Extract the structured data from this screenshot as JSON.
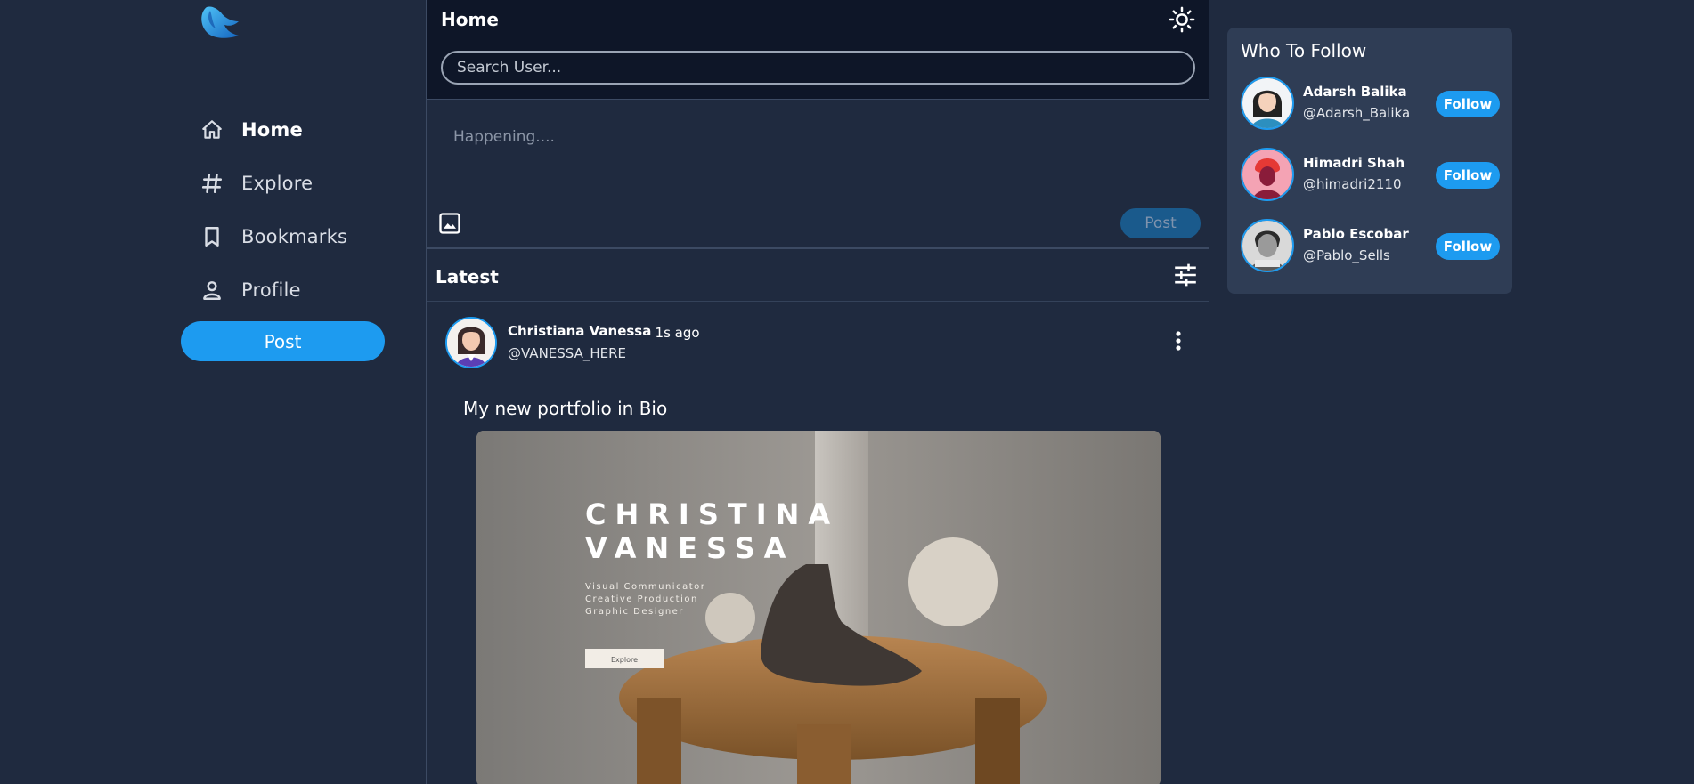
{
  "nav": {
    "items": [
      {
        "label": "Home",
        "icon": "home-icon",
        "active": true
      },
      {
        "label": "Explore",
        "icon": "hash-icon",
        "active": false
      },
      {
        "label": "Bookmarks",
        "icon": "bookmark-icon",
        "active": false
      },
      {
        "label": "Profile",
        "icon": "person-icon",
        "active": false
      }
    ],
    "post_label": "Post"
  },
  "header": {
    "title": "Home",
    "search_placeholder": "Search User..."
  },
  "composer": {
    "placeholder": "Happening....",
    "post_label": "Post"
  },
  "feed": {
    "section_title": "Latest",
    "posts": [
      {
        "name": "Christiana Vanessa",
        "time": "· 1s ago",
        "handle": "@VANESSA_HERE",
        "text": "My new portfolio in Bio",
        "image": {
          "heading_line1": "CHRISTINA",
          "heading_line2": "VANESSA",
          "sub1": "Visual Communicator",
          "sub2": "Creative Production",
          "sub3": "Graphic Designer",
          "button": "Explore"
        }
      }
    ]
  },
  "who_to_follow": {
    "title": "Who To Follow",
    "users": [
      {
        "name": "Adarsh Balika",
        "handle": "@Adarsh_Balika",
        "button": "Follow"
      },
      {
        "name": "Himadri Shah",
        "handle": "@himadri2110",
        "button": "Follow"
      },
      {
        "name": "Pablo Escobar",
        "handle": "@Pablo_Sells",
        "button": "Follow"
      }
    ]
  },
  "colors": {
    "background": "#1f2a3f",
    "header_bg": "#0e1628",
    "accent": "#1d9bf0",
    "card": "#2f3d55"
  }
}
